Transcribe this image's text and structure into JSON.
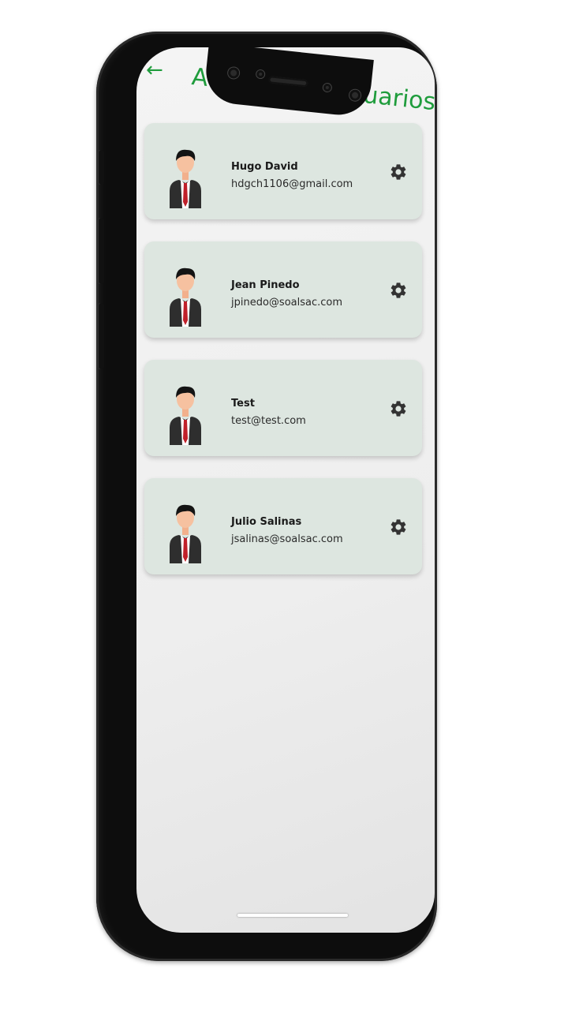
{
  "header": {
    "title": "Administrar usuarios",
    "back_icon": "arrow-left-icon",
    "accent_color": "#1f9c3c"
  },
  "users": [
    {
      "name": "Hugo David",
      "email": "hdgch1106@gmail.com"
    },
    {
      "name": "Jean Pinedo",
      "email": "jpinedo@soalsac.com"
    },
    {
      "name": "Test",
      "email": "test@test.com"
    },
    {
      "name": "Julio Salinas",
      "email": "jsalinas@soalsac.com"
    }
  ],
  "icons": {
    "avatar": "user-avatar-icon",
    "settings": "gear-icon"
  },
  "colors": {
    "card_background": "#dde6e0",
    "icon": "#333333"
  }
}
